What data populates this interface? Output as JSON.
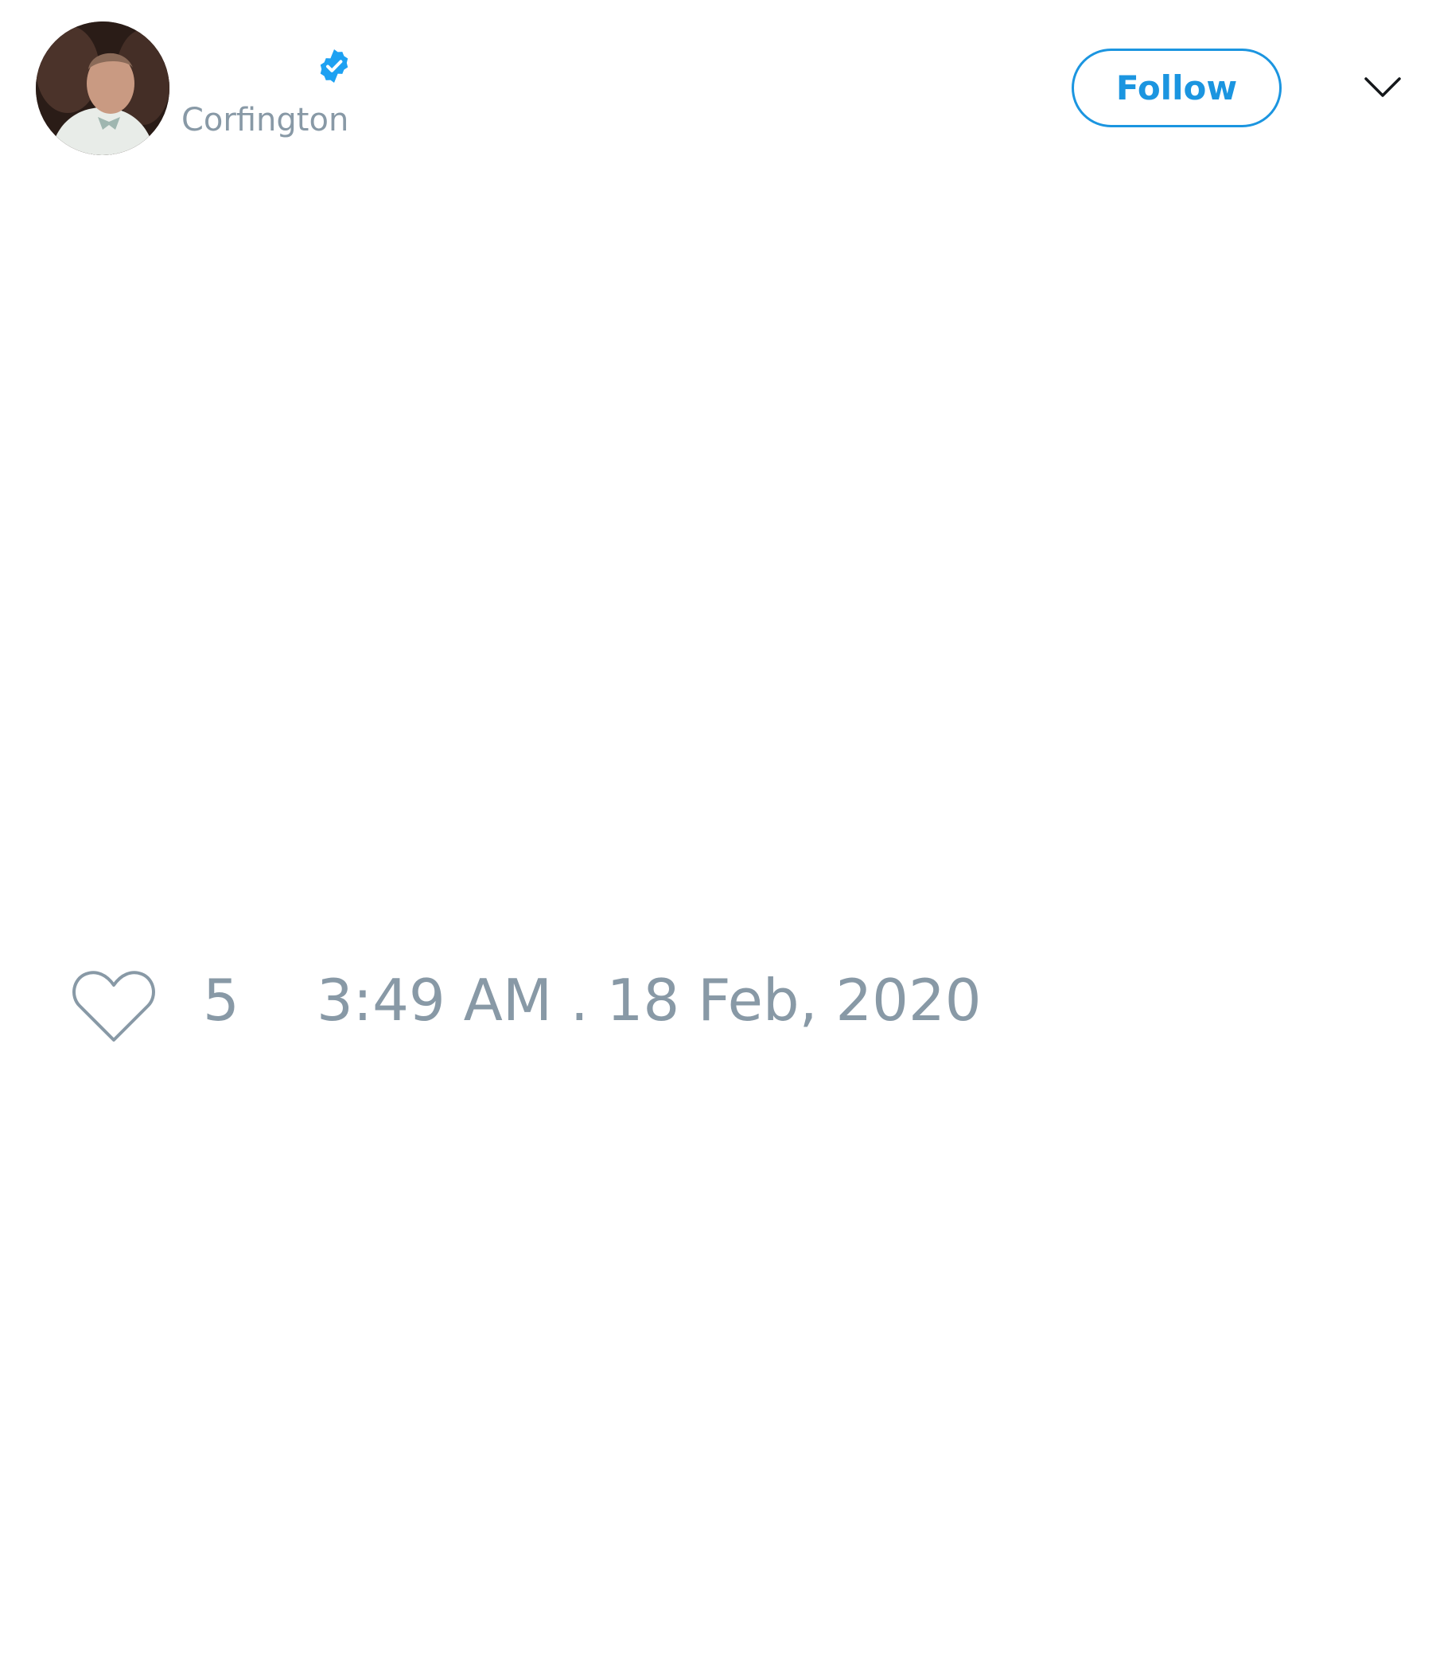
{
  "author": {
    "display_name": "",
    "handle": "Corfington",
    "verified": true,
    "avatar_icon": "profile-photo"
  },
  "actions": {
    "follow_label": "Follow",
    "menu_icon": "chevron-down-icon"
  },
  "tweet": {
    "text": ""
  },
  "footer": {
    "like_icon": "heart-icon",
    "like_count": "5",
    "timestamp": "3:49 AM . 18 Feb, 2020"
  },
  "colors": {
    "accent": "#1b95e0",
    "muted_text": "#8899a6",
    "verified_badge": "#1da1f2"
  }
}
